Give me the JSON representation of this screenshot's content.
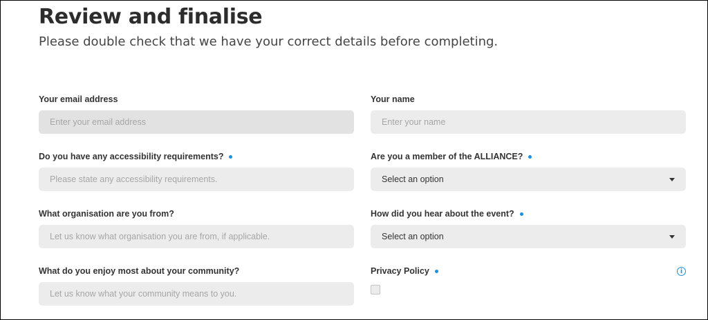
{
  "header": {
    "title": "Review and finalise",
    "subtitle": "Please double check that we have your correct details before completing."
  },
  "form": {
    "email": {
      "label": "Your email address",
      "placeholder": "Enter your email address"
    },
    "name": {
      "label": "Your name",
      "placeholder": "Enter your name"
    },
    "accessibility": {
      "label": "Do you have any accessibility requirements?",
      "placeholder": "Please state any accessibility requirements."
    },
    "alliance": {
      "label": "Are you a member of the ALLIANCE?",
      "value": "Select an option"
    },
    "organisation": {
      "label": "What organisation are you from?",
      "placeholder": "Let us know what organisation you are from, if applicable."
    },
    "hear_about": {
      "label": "How did you hear about the event?",
      "value": "Select an option"
    },
    "community": {
      "label": "What do you enjoy most about your community?",
      "placeholder": "Let us know what your community means to you."
    },
    "privacy": {
      "label": "Privacy Policy",
      "info_icon": "info-icon",
      "info_glyph": "i"
    }
  },
  "colors": {
    "accent": "#1d8fe0",
    "field_bg": "#ececec",
    "text": "#333333"
  }
}
